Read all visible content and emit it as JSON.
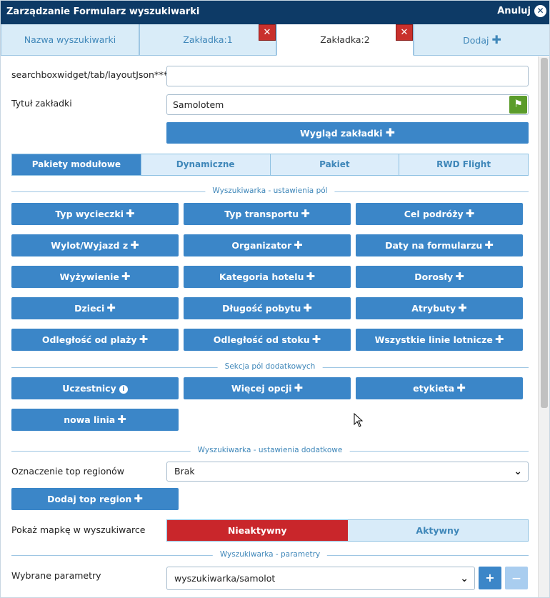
{
  "window": {
    "title": "Zarządzanie Formularz wyszukiwarki",
    "cancel_label": "Anuluj"
  },
  "tabs": [
    {
      "label": "Nazwa wyszukiwarki"
    },
    {
      "label": "Zakładka:1"
    },
    {
      "label": "Zakładka:2"
    },
    {
      "label": "Dodaj"
    }
  ],
  "form": {
    "layout_json_label": "searchboxwidget/tab/layoutJson***",
    "layout_json_value": "",
    "tab_title_label": "Tytuł zakładki",
    "tab_title_value": "Samolotem",
    "tab_look_button": "Wygląd zakładki"
  },
  "subtabs": [
    {
      "label": "Pakiety modułowe"
    },
    {
      "label": "Dynamiczne"
    },
    {
      "label": "Pakiet"
    },
    {
      "label": "RWD Flight"
    }
  ],
  "sections": {
    "fields": "Wyszukiwarka - ustawienia pól",
    "extra_fields": "Sekcja pól dodatkowych",
    "extra_settings": "Wyszukiwarka - ustawienia dodatkowe",
    "parameters": "Wyszukiwarka - parametry"
  },
  "field_buttons": [
    "Typ wycieczki",
    "Typ transportu",
    "Cel podróży",
    "Wylot/Wyjazd z",
    "Organizator",
    "Daty na formularzu",
    "Wyżywienie",
    "Kategoria hotelu",
    "Dorosły",
    "Dzieci",
    "Długość pobytu",
    "Atrybuty",
    "Odległość od plaży",
    "Odległość od stoku",
    "Wszystkie linie lotnicze"
  ],
  "extra_buttons": [
    "Uczestnicy",
    "Więcej opcji",
    "etykieta",
    "nowa linia"
  ],
  "settings": {
    "top_regions_label": "Oznaczenie top regionów",
    "top_regions_value": "Brak",
    "add_top_region_button": "Dodaj top region",
    "show_map_label": "Pokaż mapkę w wyszukiwarce",
    "map_off": "Nieaktywny",
    "map_on": "Aktywny"
  },
  "parameters": {
    "selected_label": "Wybrane parametry",
    "selected_value": "wyszukiwarka/samolot",
    "add_symbol": "+",
    "remove_symbol": "—"
  },
  "colors": {
    "primary": "#3b86c8",
    "header": "#0d3a66",
    "danger": "#c9262b"
  }
}
